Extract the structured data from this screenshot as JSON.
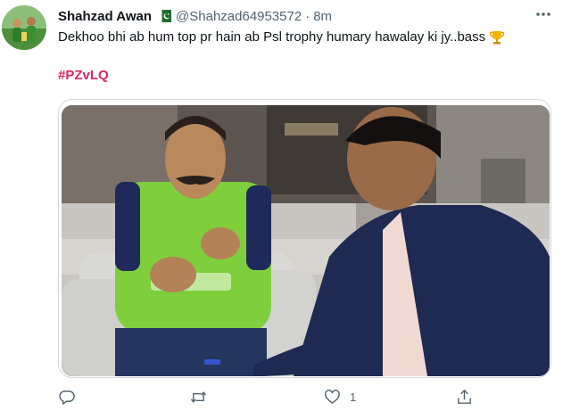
{
  "tweet": {
    "author_name": "Shahzad Awan",
    "handle": "@Shahzad64953572",
    "separator": "·",
    "time": "8m",
    "text": "Dekhoo bhi ab hum top pr hain ab Psl trophy humary hawalay ki jy..bass",
    "hashtag": "#PZvLQ",
    "verified_flag_icon": "pakistan-flag-icon",
    "emoji_icon": "trophy-icon",
    "hashtag_color": "#e0245e"
  },
  "actions": {
    "reply_count": "",
    "retweet_count": "",
    "like_count": "1",
    "share_count": ""
  }
}
